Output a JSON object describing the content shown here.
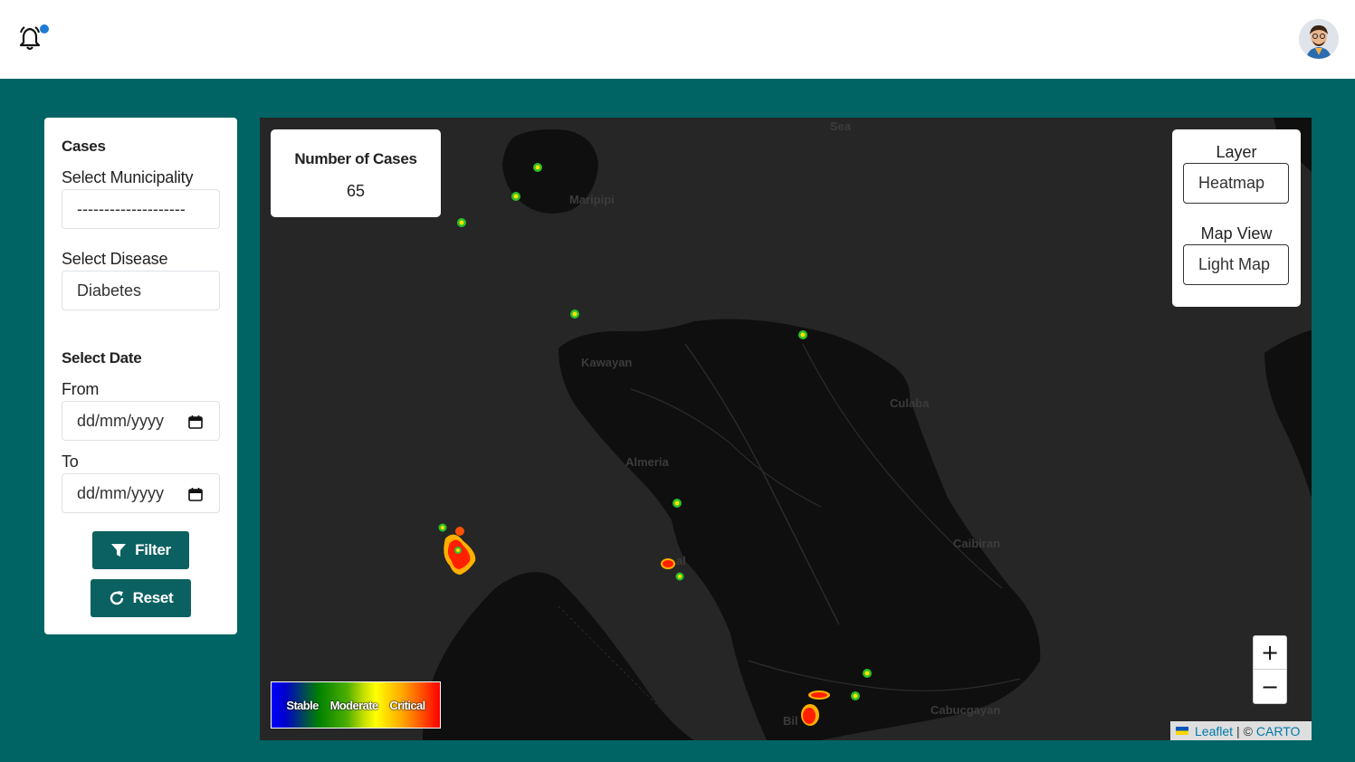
{
  "header": {
    "notification_icon": "bell-icon",
    "avatar_icon": "user-avatar"
  },
  "sidebar": {
    "cases_title": "Cases",
    "municipality_label": "Select Municipality",
    "municipality_value": "--------------------",
    "disease_label": "Select Disease",
    "disease_value": "Diabetes",
    "date_title": "Select Date",
    "from_label": "From",
    "from_value": "dd/mm/yyyy",
    "to_label": "To",
    "to_value": "dd/mm/yyyy",
    "filter_label": "Filter",
    "reset_label": "Reset"
  },
  "map": {
    "cases_card_title": "Number of Cases",
    "cases_count": "65",
    "layer_label": "Layer",
    "layer_value": "Heatmap",
    "view_label": "Map View",
    "view_value": "Light Map",
    "legend": {
      "stable": "Stable",
      "moderate": "Moderate",
      "critical": "Critical"
    },
    "zoom_in": "+",
    "zoom_out": "−",
    "attribution_leaflet": "Leaflet",
    "attribution_sep": "| ©",
    "attribution_carto": "CARTO",
    "places": {
      "sea": "Sea",
      "maripipi": "Maripipi",
      "kawayan": "Kawayan",
      "culaba": "Culaba",
      "almeria": "Almeria",
      "caibiran": "Caibiran",
      "naval": "al",
      "cabucgayan": "Cabucgayan",
      "biliran": "Bil"
    }
  },
  "colors": {
    "brand": "#006464",
    "button": "#0b6161",
    "map_bg": "#262626",
    "land": "#0f0f0f",
    "notification_dot": "#1e7bd6",
    "link": "#0078a8"
  }
}
